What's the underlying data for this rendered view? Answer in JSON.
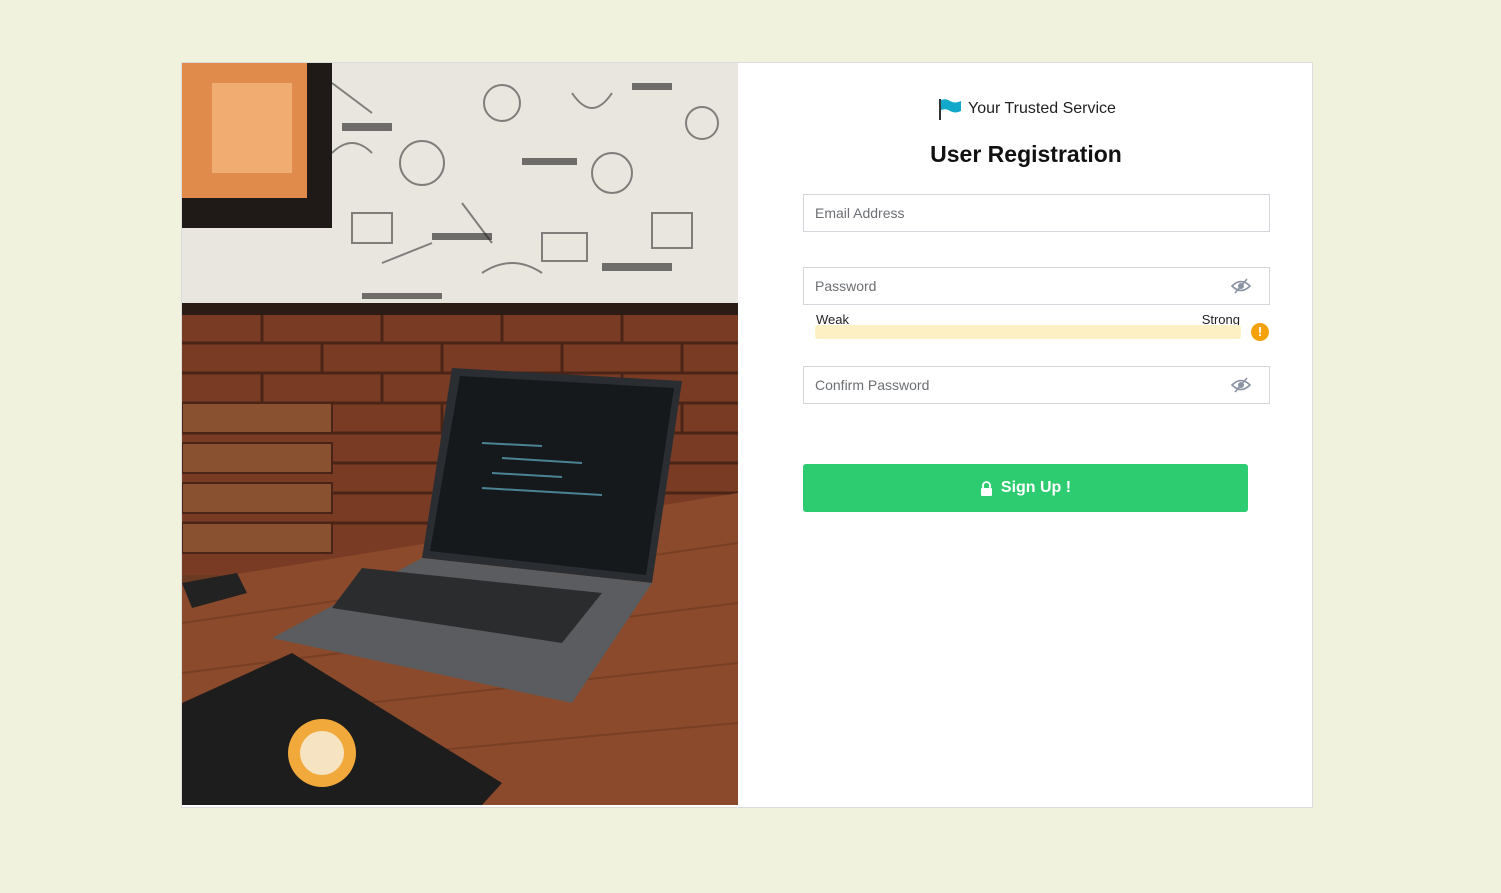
{
  "brand": {
    "name": "Your Trusted Service",
    "icon": "flag-icon"
  },
  "form": {
    "title": "User Registration",
    "email_placeholder": "Email Address",
    "password_placeholder": "Password",
    "confirm_placeholder": "Confirm Password",
    "eye_icon": "eye-slash-icon"
  },
  "strength_meter": {
    "weak_label": "Weak",
    "strong_label": "Strong",
    "level": 0,
    "warning_icon": "exclamation-circle-icon",
    "warning_glyph": "!"
  },
  "signup": {
    "label": "Sign Up !",
    "icon": "lock-icon"
  },
  "colors": {
    "background": "#f1f2de",
    "button": "#2ecc71",
    "meter_track": "#fdf1c3",
    "warning": "#f4a20b",
    "flag": "#12a8c9"
  }
}
